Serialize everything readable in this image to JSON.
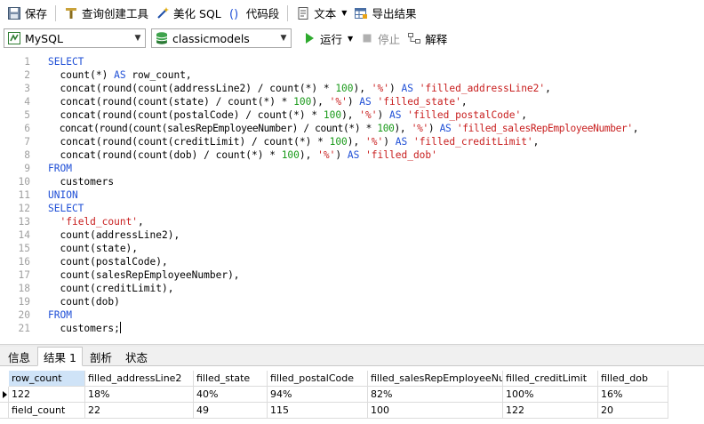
{
  "toolbar": {
    "save": "保存",
    "query_builder": "查询创建工具",
    "beautify": "美化 SQL",
    "code_snippet": "代码段",
    "text": "文本",
    "export": "导出结果"
  },
  "connection": {
    "engine": "MySQL",
    "database": "classicmodels",
    "run": "运行",
    "stop": "停止",
    "explain": "解释"
  },
  "editor": {
    "lines": [
      {
        "n": "1"
      },
      {
        "n": "2"
      },
      {
        "n": "3"
      },
      {
        "n": "4"
      },
      {
        "n": "5"
      },
      {
        "n": "6"
      },
      {
        "n": "7"
      },
      {
        "n": "8"
      },
      {
        "n": "9"
      },
      {
        "n": "10"
      },
      {
        "n": "11"
      },
      {
        "n": "12"
      },
      {
        "n": "13"
      },
      {
        "n": "14"
      },
      {
        "n": "15"
      },
      {
        "n": "16"
      },
      {
        "n": "17"
      },
      {
        "n": "18"
      },
      {
        "n": "19"
      },
      {
        "n": "20"
      },
      {
        "n": "21"
      }
    ],
    "tokens": {
      "l1": [
        "SELECT"
      ],
      "l2": [
        "  count(*) ",
        "AS",
        " row_count,"
      ],
      "l3": [
        "  concat(round(count(addressLine2) / count(*) * ",
        "100",
        "), ",
        "'%'",
        ") ",
        "AS",
        " ",
        "'filled_addressLine2'",
        ","
      ],
      "l4": [
        "  concat(round(count(state) / count(*) * ",
        "100",
        "), ",
        "'%'",
        ") ",
        "AS",
        " ",
        "'filled_state'",
        ","
      ],
      "l5": [
        "  concat(round(count(postalCode) / count(*) * ",
        "100",
        "), ",
        "'%'",
        ") ",
        "AS",
        " ",
        "'filled_postalCode'",
        ","
      ],
      "l6": [
        "  concat(round(count(salesRepEmployeeNumber) / count(*) * ",
        "100",
        "), ",
        "'%'",
        ") ",
        "AS",
        " ",
        "'filled_salesRepEmployeeNumber'",
        ","
      ],
      "l7": [
        "  concat(round(count(creditLimit) / count(*) * ",
        "100",
        "), ",
        "'%'",
        ") ",
        "AS",
        " ",
        "'filled_creditLimit'",
        ","
      ],
      "l8": [
        "  concat(round(count(dob) / count(*) * ",
        "100",
        "), ",
        "'%'",
        ") ",
        "AS",
        " ",
        "'filled_dob'"
      ],
      "l9": [
        "FROM"
      ],
      "l10": [
        "  customers"
      ],
      "l11": [
        "UNION"
      ],
      "l12": [
        "SELECT"
      ],
      "l13": [
        "  ",
        "'field_count'",
        ","
      ],
      "l14": [
        "  count(addressLine2),"
      ],
      "l15": [
        "  count(state),"
      ],
      "l16": [
        "  count(postalCode),"
      ],
      "l17": [
        "  count(salesRepEmployeeNumber),"
      ],
      "l18": [
        "  count(creditLimit),"
      ],
      "l19": [
        "  count(dob)"
      ],
      "l20": [
        "FROM"
      ],
      "l21": [
        "  customers;"
      ]
    }
  },
  "tabs": {
    "info": "信息",
    "result1": "结果 1",
    "profile": "剖析",
    "status": "状态"
  },
  "result": {
    "columns": [
      "row_count",
      "filled_addressLine2",
      "filled_state",
      "filled_postalCode",
      "filled_salesRepEmployeeNumbe",
      "filled_creditLimit",
      "filled_dob"
    ],
    "rows": [
      [
        "122",
        "18%",
        "40%",
        "94%",
        "82%",
        "100%",
        "16%"
      ],
      [
        "field_count",
        "22",
        "49",
        "115",
        "100",
        "122",
        "20"
      ]
    ]
  },
  "colors": {
    "keyword": "#1f4fd6",
    "string": "#c81e1e",
    "number": "#1a9a1a",
    "header_selected": "#cfe3f7"
  }
}
